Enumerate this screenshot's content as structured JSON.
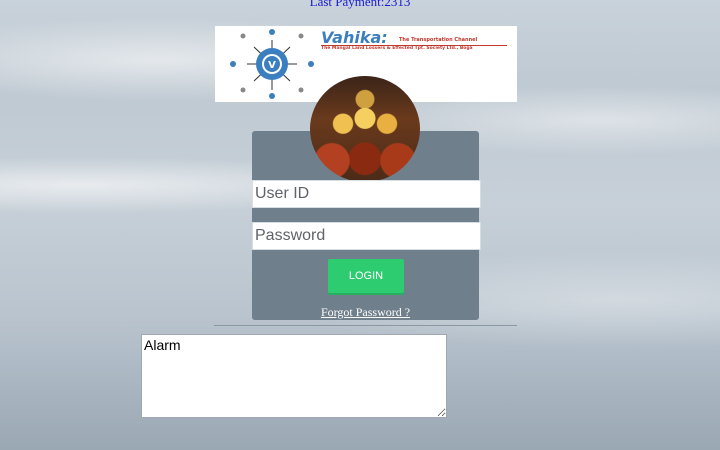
{
  "header": {
    "last_payment": "Last Payment:2313"
  },
  "logo": {
    "title": "Vahika:",
    "tagline": "The Transportation Channel",
    "subtitle": "The Mangal Land Lossers & Effected Tpt. Society Ltd., Boga",
    "mark_letter": "V"
  },
  "login": {
    "user_placeholder": "User ID",
    "password_placeholder": "Password",
    "login_label": "LOGIN",
    "forgot_label": "Forgot Password ?"
  },
  "alarm": {
    "value": "Alarm"
  },
  "colors": {
    "login_button": "#2ecc71",
    "panel": "#6f7f8c",
    "logo_blue": "#3b7fc0",
    "logo_red": "#c0392b",
    "header_text": "#1a1ad6"
  }
}
